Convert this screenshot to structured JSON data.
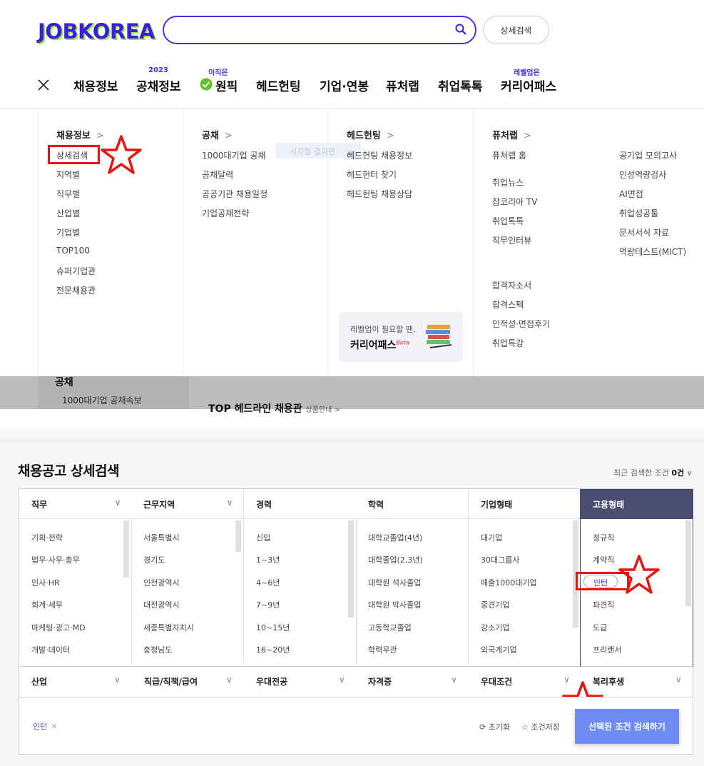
{
  "header": {
    "logo": "JOBKOREA",
    "search_placeholder": "",
    "advanced_search_button": "상세검색"
  },
  "nav": {
    "items": [
      {
        "label": "채용정보",
        "sup": ""
      },
      {
        "label": "공채정보",
        "sup": "2023"
      },
      {
        "label": "원픽",
        "sup": "이직은"
      },
      {
        "label": "헤드헌팅",
        "sup": ""
      },
      {
        "label": "기업·연봉",
        "sup": ""
      },
      {
        "label": "퓨처랩",
        "sup": ""
      },
      {
        "label": "취업톡톡",
        "sup": ""
      },
      {
        "label": "커리어패스",
        "sup": "레벨업은"
      }
    ]
  },
  "menu": {
    "col1": {
      "title": "채용정보",
      "links": [
        "상세검색",
        "지역별",
        "직무별",
        "산업별",
        "기업별",
        "TOP100",
        "슈퍼기업관",
        "전문채용관"
      ]
    },
    "col2": {
      "title": "공채",
      "links": [
        "1000대기업 공채",
        "공채달력",
        "공공기관 채용일정",
        "기업공채전략"
      ]
    },
    "col3": {
      "title": "헤드헌팅",
      "links": [
        "헤드헌팅 채용정보",
        "헤드헌터 찾기",
        "헤드헌팅 채용상담"
      ],
      "ghost": "시각형 결과면"
    },
    "col4": {
      "title": "퓨처랩",
      "links_a": [
        "퓨처랩 홈"
      ],
      "links_b": [
        "취업뉴스",
        "잡코리아 TV",
        "취업톡톡",
        "직무인터뷰"
      ],
      "links_c": [
        "합격자소서",
        "합격스펙",
        "인적성·면접후기",
        "취업특강"
      ],
      "links_d": [
        "공기업 모의고사",
        "인성역량검사",
        "AI면접",
        "취업성공툴",
        "문서서식 자료",
        "역량테스트(MICT)"
      ]
    },
    "career_card": {
      "sub": "레벨업이 필요할 땐,",
      "title": "커리어패스",
      "beta": "Beta"
    }
  },
  "band": {
    "t1": "공채",
    "t2": "1000대기업 공채속보",
    "t3": "TOP 헤드라인 채용관",
    "t3_small": "상품안내 >"
  },
  "panel": {
    "title": "채용공고 상세검색",
    "recent_label": "최근 검색한 조건",
    "recent_count": "0건",
    "columns": [
      {
        "title": "직무",
        "items": [
          "기획·전략",
          "법무·사무·총무",
          "인사·HR",
          "회계·세무",
          "마케팅·광고·MD",
          "개발·데이터"
        ]
      },
      {
        "title": "근무지역",
        "items": [
          "서울특별시",
          "경기도",
          "인천광역시",
          "대전광역시",
          "세종특별자치시",
          "충청남도"
        ]
      },
      {
        "title": "경력",
        "items": [
          "신입",
          "1~3년",
          "4~6년",
          "7~9년",
          "10~15년",
          "16~20년"
        ]
      },
      {
        "title": "학력",
        "items": [
          "대학교졸업(4년)",
          "대학졸업(2,3년)",
          "대학원 석사졸업",
          "대학원 박사졸업",
          "고등학교졸업",
          "학력무관"
        ]
      },
      {
        "title": "기업형태",
        "items": [
          "대기업",
          "30대그룹사",
          "매출1000대기업",
          "중견기업",
          "강소기업",
          "외국계기업"
        ]
      },
      {
        "title": "고용형태",
        "items": [
          "정규직",
          "계약직",
          "인턴",
          "파견직",
          "도급",
          "프리랜서"
        ]
      }
    ],
    "filters": [
      "산업",
      "직급/직책/급여",
      "우대전공",
      "자격증",
      "우대조건",
      "복리후생"
    ],
    "selected_chip": "인턴",
    "reset_label": "초기화",
    "save_label": "조건저장",
    "submit_label": "선택된 조건 검색하기"
  },
  "colors": {
    "brand": "#3c1fd6",
    "brand_accent": "#8ef034",
    "active_header": "#4b4d70",
    "submit": "#6f8cf4",
    "highlight": "#e8140f"
  }
}
